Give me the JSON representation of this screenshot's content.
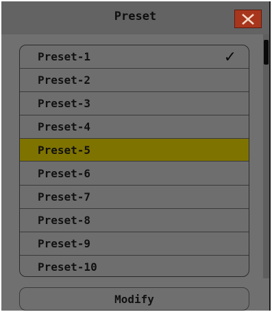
{
  "dialog": {
    "title": "Preset",
    "close_icon": "close-x-icon",
    "colors": {
      "close_button": "#a8361c",
      "selected_row": "#7f7300",
      "background": "#707070"
    }
  },
  "presets": {
    "items": [
      {
        "label": "Preset-1",
        "checked": true
      },
      {
        "label": "Preset-2",
        "checked": false
      },
      {
        "label": "Preset-3",
        "checked": false
      },
      {
        "label": "Preset-4",
        "checked": false
      },
      {
        "label": "Preset-5",
        "checked": false
      },
      {
        "label": "Preset-6",
        "checked": false
      },
      {
        "label": "Preset-7",
        "checked": false
      },
      {
        "label": "Preset-8",
        "checked": false
      },
      {
        "label": "Preset-9",
        "checked": false
      },
      {
        "label": "Preset-10",
        "checked": false
      }
    ],
    "selected_index": 4,
    "check_icon": "checkmark-icon",
    "check_glyph": "✓"
  },
  "actions": {
    "modify_label": "Modify"
  }
}
